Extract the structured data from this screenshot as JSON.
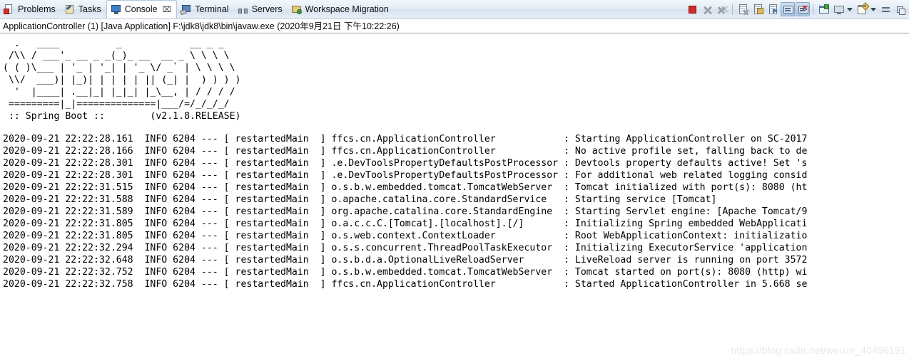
{
  "tabs": [
    {
      "label": "Problems",
      "icon": "problems-icon",
      "active": false,
      "closable": false
    },
    {
      "label": "Tasks",
      "icon": "tasks-icon",
      "active": false,
      "closable": false
    },
    {
      "label": "Console",
      "icon": "console-icon",
      "active": true,
      "closable": true,
      "close_glyph": "⌧"
    },
    {
      "label": "Terminal",
      "icon": "terminal-icon",
      "active": false,
      "closable": false
    },
    {
      "label": "Servers",
      "icon": "servers-icon",
      "active": false,
      "closable": false
    },
    {
      "label": "Workspace Migration",
      "icon": "workspace-migration-icon",
      "active": false,
      "closable": false
    }
  ],
  "toolbar": {
    "buttons": [
      {
        "name": "terminate-button",
        "icon": "stop-icon",
        "toggled": false
      },
      {
        "name": "remove-launch-button",
        "icon": "x-icon",
        "toggled": false
      },
      {
        "name": "remove-all-terminated-button",
        "icon": "double-x-icon",
        "toggled": false
      },
      {
        "name": "clear-console-button",
        "icon": "clear-console-icon",
        "toggled": false
      },
      {
        "name": "scroll-lock-button",
        "icon": "lock-icon",
        "toggled": false
      },
      {
        "name": "word-wrap-button",
        "icon": "word-wrap-icon",
        "toggled": false
      },
      {
        "name": "show-console-on-output-button",
        "icon": "console-window-icon",
        "toggled": true
      },
      {
        "name": "show-console-on-error-button",
        "icon": "console-error-icon",
        "toggled": true
      },
      {
        "name": "open-console-button",
        "icon": "open-console-icon",
        "toggled": false
      },
      {
        "name": "display-selected-console-button",
        "icon": "monitor-icon",
        "toggled": false
      },
      {
        "name": "new-console-view-button",
        "icon": "new-console-icon",
        "toggled": false
      },
      {
        "name": "minimize-button",
        "icon": "minimize-icon",
        "toggled": false
      },
      {
        "name": "maximize-button",
        "icon": "maximize-icon",
        "toggled": false
      }
    ]
  },
  "launch_line": "ApplicationController (1) [Java Application] F:\\jdk8\\jdk8\\bin\\javaw.exe (2020年9月21日 下午10:22:26)",
  "banner": {
    "ascii": "  .   ____          _            __ _ _\n /\\\\ / ___'_ __ _ _(_)_ __  __ _ \\ \\ \\ \\\n( ( )\\___ | '_ | '_| | '_ \\/ _` | \\ \\ \\ \\\n \\\\/  ___)| |_)| | | | | || (_| |  ) ) ) )\n  '  |____| .__|_| |_|_| |_\\__, | / / / /\n =========|_|==============|___/=/_/_/_/",
    "footer_left": " :: Spring Boot :: ",
    "footer_version": "(v2.1.8.RELEASE)",
    "footer_line": " :: Spring Boot ::        (v2.1.8.RELEASE)"
  },
  "log": {
    "columns": [
      "timestamp",
      "level",
      "pid",
      "sep",
      "thread",
      "logger",
      "colon",
      "message"
    ],
    "lines": [
      {
        "timestamp": "2020-09-21 22:22:28.161",
        "level": "INFO",
        "pid": "6204",
        "sep": "---",
        "thread": "restartedMain",
        "logger": "ffcs.cn.ApplicationController",
        "message": "Starting ApplicationController on SC-2017"
      },
      {
        "timestamp": "2020-09-21 22:22:28.166",
        "level": "INFO",
        "pid": "6204",
        "sep": "---",
        "thread": "restartedMain",
        "logger": "ffcs.cn.ApplicationController",
        "message": "No active profile set, falling back to de"
      },
      {
        "timestamp": "2020-09-21 22:22:28.301",
        "level": "INFO",
        "pid": "6204",
        "sep": "---",
        "thread": "restartedMain",
        "logger": ".e.DevToolsPropertyDefaultsPostProcessor",
        "message": "Devtools property defaults active! Set 's"
      },
      {
        "timestamp": "2020-09-21 22:22:28.301",
        "level": "INFO",
        "pid": "6204",
        "sep": "---",
        "thread": "restartedMain",
        "logger": ".e.DevToolsPropertyDefaultsPostProcessor",
        "message": "For additional web related logging consid"
      },
      {
        "timestamp": "2020-09-21 22:22:31.515",
        "level": "INFO",
        "pid": "6204",
        "sep": "---",
        "thread": "restartedMain",
        "logger": "o.s.b.w.embedded.tomcat.TomcatWebServer",
        "message": "Tomcat initialized with port(s): 8080 (ht"
      },
      {
        "timestamp": "2020-09-21 22:22:31.588",
        "level": "INFO",
        "pid": "6204",
        "sep": "---",
        "thread": "restartedMain",
        "logger": "o.apache.catalina.core.StandardService",
        "message": "Starting service [Tomcat]"
      },
      {
        "timestamp": "2020-09-21 22:22:31.589",
        "level": "INFO",
        "pid": "6204",
        "sep": "---",
        "thread": "restartedMain",
        "logger": "org.apache.catalina.core.StandardEngine",
        "message": "Starting Servlet engine: [Apache Tomcat/9"
      },
      {
        "timestamp": "2020-09-21 22:22:31.805",
        "level": "INFO",
        "pid": "6204",
        "sep": "---",
        "thread": "restartedMain",
        "logger": "o.a.c.c.C.[Tomcat].[localhost].[/]",
        "message": "Initializing Spring embedded WebApplicati"
      },
      {
        "timestamp": "2020-09-21 22:22:31.805",
        "level": "INFO",
        "pid": "6204",
        "sep": "---",
        "thread": "restartedMain",
        "logger": "o.s.web.context.ContextLoader",
        "message": "Root WebApplicationContext: initializatio"
      },
      {
        "timestamp": "2020-09-21 22:22:32.294",
        "level": "INFO",
        "pid": "6204",
        "sep": "---",
        "thread": "restartedMain",
        "logger": "o.s.s.concurrent.ThreadPoolTaskExecutor",
        "message": "Initializing ExecutorService 'application"
      },
      {
        "timestamp": "2020-09-21 22:22:32.648",
        "level": "INFO",
        "pid": "6204",
        "sep": "---",
        "thread": "restartedMain",
        "logger": "o.s.b.d.a.OptionalLiveReloadServer",
        "message": "LiveReload server is running on port 3572"
      },
      {
        "timestamp": "2020-09-21 22:22:32.752",
        "level": "INFO",
        "pid": "6204",
        "sep": "---",
        "thread": "restartedMain",
        "logger": "o.s.b.w.embedded.tomcat.TomcatWebServer",
        "message": "Tomcat started on port(s): 8080 (http) wi"
      },
      {
        "timestamp": "2020-09-21 22:22:32.758",
        "level": "INFO",
        "pid": "6204",
        "sep": "---",
        "thread": "restartedMain",
        "logger": "ffcs.cn.ApplicationController",
        "message": "Started ApplicationController in 5.668 se"
      }
    ]
  },
  "watermark": "https://blog.csdn.net/weixin_40496191",
  "colors": {
    "tab_active_bg": "#ffffff",
    "tabbar_bg": "#e3ebf5",
    "console_bg": "#ffffff",
    "text": "#000000",
    "stop_red": "#cf2b2b",
    "watermark": "#e8e8e8"
  }
}
